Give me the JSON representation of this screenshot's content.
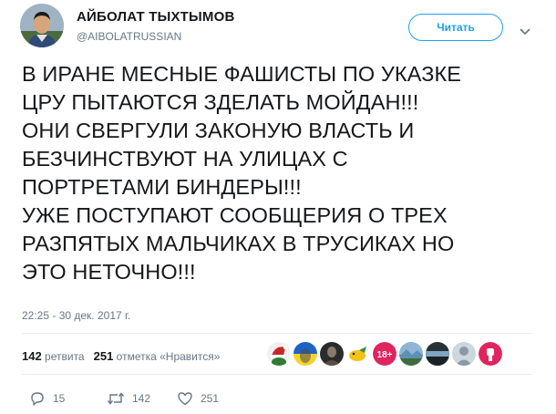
{
  "author": {
    "name": "АЙБОЛАТ ТЫХТЫМОВ",
    "handle": "@AIBOLATRUSSIAN"
  },
  "follow_button": {
    "label": "Читать"
  },
  "tweet": {
    "text": "В ИРАНЕ МЕСНЫЕ ФАШИСТЫ ПО УКАЗКЕ\nЦРУ ПЫТАЮТСЯ ЗДЕЛАТЬ МОЙДАН!!!\nОНИ СВЕРГУЛИ ЗАКОНУЮ ВЛАСТЬ И\nБЕЗЧИНСТВУЮТ НА УЛИЦАХ С\nПОРТРЕТАМИ БИНДЕРЫ!!!\nУЖЕ ПОСТУПАЮТ СООБЩЕРИЯ О ТРЕХ\nРАЗПЯТЫХ МАЛЬЧИКАХ В ТРУСИКАХ НО\nЭТО НЕТОЧНО!!!",
    "timestamp": "22:25 - 30 дек. 2017 г."
  },
  "stats": {
    "retweets_count": "142",
    "retweets_label": "ретвита",
    "likes_count": "251",
    "likes_label": "отметка «Нравится»"
  },
  "likers": [
    {
      "icon": "santa-hat-avatar",
      "colors": [
        "#c62828",
        "#ffffff",
        "#2e7d32"
      ]
    },
    {
      "icon": "ukraine-flag-avatar",
      "colors": [
        "#1e63c4",
        "#f3d22b"
      ]
    },
    {
      "icon": "dark-portrait-avatar",
      "colors": [
        "#2b2b2b",
        "#8a7a6a"
      ]
    },
    {
      "icon": "yellow-bird-avatar",
      "colors": [
        "#f2c318",
        "#3e8e41"
      ]
    },
    {
      "icon": "18-plus-badge-avatar",
      "label": "18+",
      "colors": [
        "#e0245e",
        "#ffffff"
      ]
    },
    {
      "icon": "landscape-avatar",
      "colors": [
        "#5f8fb4",
        "#3d6b3d"
      ]
    },
    {
      "icon": "coastline-avatar",
      "colors": [
        "#263238",
        "#7fa6c2"
      ]
    },
    {
      "icon": "default-user-avatar",
      "colors": [
        "#ccd6dd",
        "#8899a6"
      ]
    },
    {
      "icon": "red-fist-avatar",
      "colors": [
        "#e0245e",
        "#ffffff"
      ]
    }
  ],
  "actions": {
    "replies": "15",
    "retweets": "142",
    "likes": "251"
  },
  "colors": {
    "accent": "#1da1f2",
    "text": "#14171a",
    "muted": "#657786",
    "divider": "#e6ecf0"
  }
}
